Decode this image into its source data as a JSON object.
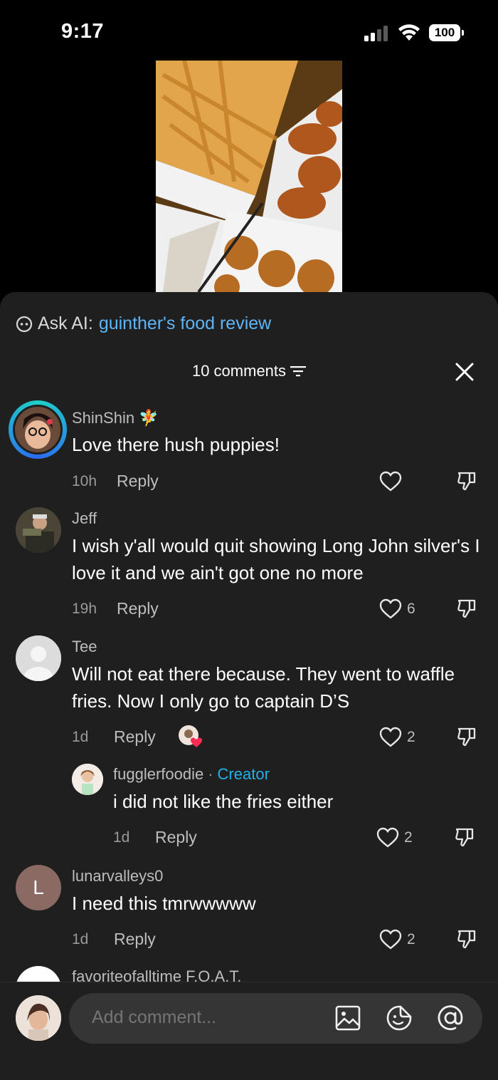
{
  "status_bar": {
    "time": "9:17",
    "battery": "100"
  },
  "ask_ai": {
    "label": "Ask AI:",
    "query": "guinther's food review"
  },
  "header": {
    "comment_count": "10 comments"
  },
  "comments": [
    {
      "username": "ShinShin",
      "text": "Love there hush puppies!",
      "time": "10h",
      "reply_label": "Reply",
      "likes": ""
    },
    {
      "username": "Jeff",
      "text": "I wish y'all would quit showing Long John silver's I love it and we ain't got one no more",
      "time": "19h",
      "reply_label": "Reply",
      "likes": "6"
    },
    {
      "username": "Tee",
      "text": "Will not eat there because. They went to waffle fries. Now I only go to captain D’S",
      "time": "1d",
      "reply_label": "Reply",
      "likes": "2"
    },
    {
      "username": "fugglerfoodie",
      "badge": "Creator",
      "text": "i did not like the fries either",
      "time": "1d",
      "reply_label": "Reply",
      "likes": "2"
    },
    {
      "username": "lunarvalleys0",
      "avatar_letter": "L",
      "text": "I need this tmrwwwww",
      "time": "1d",
      "reply_label": "Reply",
      "likes": "2"
    },
    {
      "username": "favoriteofalltime F.O.A.T."
    }
  ],
  "composer": {
    "placeholder": "Add comment..."
  },
  "colors": {
    "sheet": "#1f1f1f",
    "accent_link": "#5fb4f5",
    "creator_badge": "#22b1e6"
  }
}
